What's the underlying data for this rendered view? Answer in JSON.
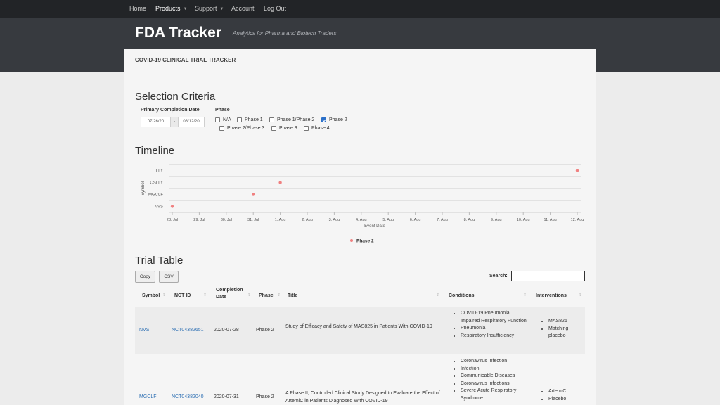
{
  "nav": {
    "home": "Home",
    "products": "Products",
    "support": "Support",
    "account": "Account",
    "logout": "Log Out"
  },
  "brand": {
    "title": "FDA Tracker",
    "subtitle": "Analytics for Pharma and Biotech Traders"
  },
  "page": {
    "subtitle": "COVID-19 CLINICAL TRIAL TRACKER"
  },
  "selection": {
    "heading": "Selection Criteria",
    "date_label": "Primary Completion Date",
    "date_start": "07/26/20",
    "date_sep": "-",
    "date_end": "08/12/20",
    "phase_label": "Phase",
    "phases": [
      {
        "label": "N/A",
        "checked": false
      },
      {
        "label": "Phase 1",
        "checked": false
      },
      {
        "label": "Phase 1/Phase 2",
        "checked": false
      },
      {
        "label": "Phase 2",
        "checked": true
      },
      {
        "label": "Phase 2/Phase 3",
        "checked": false
      },
      {
        "label": "Phase 3",
        "checked": false
      },
      {
        "label": "Phase 4",
        "checked": false
      }
    ]
  },
  "timeline": {
    "heading": "Timeline"
  },
  "chart_data": {
    "type": "scatter",
    "title": "",
    "xlabel": "Event Date",
    "ylabel": "Symbol",
    "x_ticks": [
      "28. Jul",
      "29. Jul",
      "30. Jul",
      "31. Jul",
      "1. Aug",
      "2. Aug",
      "3. Aug",
      "4. Aug",
      "5. Aug",
      "6. Aug",
      "7. Aug",
      "8. Aug",
      "9. Aug",
      "10. Aug",
      "11. Aug",
      "12. Aug"
    ],
    "categories": [
      "LLY",
      "CSLLY",
      "MGCLF",
      "NVS"
    ],
    "series": [
      {
        "name": "Phase 2",
        "color": "#f08080",
        "points": [
          {
            "x": "2020-07-28",
            "y": "NVS"
          },
          {
            "x": "2020-07-31",
            "y": "MGCLF"
          },
          {
            "x": "2020-08-01",
            "y": "CSLLY"
          },
          {
            "x": "2020-08-12",
            "y": "LLY"
          }
        ]
      }
    ],
    "grid": true,
    "legend": "bottom-center"
  },
  "table": {
    "heading": "Trial Table",
    "copy_label": "Copy",
    "csv_label": "CSV",
    "search_label": "Search:",
    "search_value": "",
    "columns": [
      "Symbol",
      "NCT ID",
      "Completion Date",
      "Phase",
      "Title",
      "Conditions",
      "Interventions"
    ],
    "col_completion_1": "Completion",
    "col_completion_2": "Date",
    "rows": [
      {
        "symbol": "NVS",
        "nct": "NCT04382651",
        "date": "2020-07-28",
        "phase": "Phase 2",
        "title": "Study of Efficacy and Safety of MAS825 in Patients With COVID-19",
        "conditions": [
          "COVID-19 Pneumonia, Impaired Respiratory Function",
          "Pneumonia",
          "Respiratory Insufficiency"
        ],
        "interventions": [
          "MAS825",
          "Matching placebo"
        ]
      },
      {
        "symbol": "MGCLF",
        "nct": "NCT04382040",
        "date": "2020-07-31",
        "phase": "Phase 2",
        "title": "A Phase II, Controlled Clinical Study Designed to Evaluate the Effect of ArtemiC in Patients Diagnosed With COVID-19",
        "conditions": [
          "Coronavirus Infection",
          "Infection",
          "Communicable Diseases",
          "Coronavirus Infections",
          "Severe Acute Respiratory Syndrome"
        ],
        "interventions": [
          "ArtemiC",
          "Placebo"
        ]
      }
    ]
  }
}
